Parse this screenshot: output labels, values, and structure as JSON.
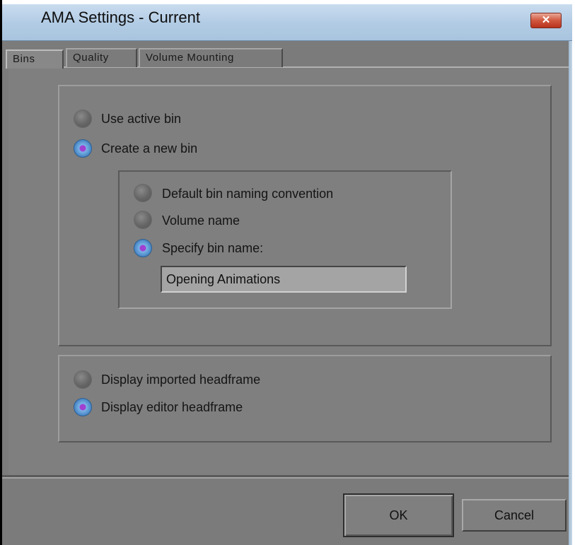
{
  "window": {
    "title": "AMA Settings - Current",
    "close_glyph": "✕"
  },
  "tabs": [
    {
      "label": "Bins",
      "active": true
    },
    {
      "label": "Quality",
      "active": false
    },
    {
      "label": "Volume Mounting",
      "active": false
    }
  ],
  "bins_group": {
    "options": [
      {
        "label": "Use active bin",
        "selected": false
      },
      {
        "label": "Create a new bin",
        "selected": true
      }
    ],
    "naming": {
      "options": [
        {
          "label": "Default bin naming convention",
          "selected": false
        },
        {
          "label": "Volume name",
          "selected": false
        },
        {
          "label": "Specify bin name:",
          "selected": true
        }
      ],
      "bin_name_value": "Opening Animations"
    }
  },
  "headframe_group": {
    "options": [
      {
        "label": "Display imported headframe",
        "selected": false
      },
      {
        "label": "Display editor headframe",
        "selected": true
      }
    ]
  },
  "buttons": {
    "ok_label": "OK",
    "cancel_label": "Cancel"
  },
  "colors": {
    "window_bg": "#7b7b7b",
    "titlebar": "#b8d0e8",
    "radio_selected_dot": "#a040d0",
    "radio_selected_ring": "#5a98d6",
    "close_button": "#c94a33"
  }
}
